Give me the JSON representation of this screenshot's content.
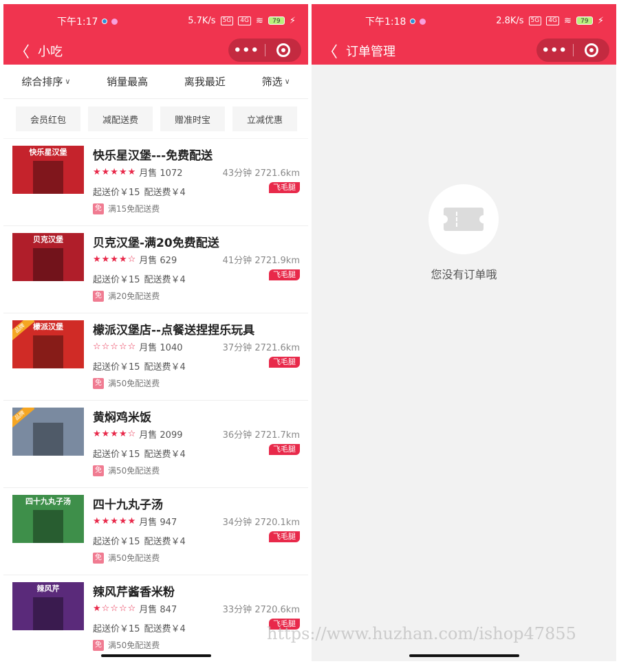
{
  "left": {
    "status": {
      "time": "下午1:17",
      "speed": "5.7K/s",
      "battery": "79"
    },
    "title": "小吃",
    "sort": [
      "综合排序",
      "销量最高",
      "离我最近",
      "筛选"
    ],
    "chips": [
      "会员红包",
      "减配送费",
      "赠准时宝",
      "立减优惠"
    ],
    "stores": [
      {
        "name": "快乐星汉堡---免费配送",
        "stars": "★★★★★",
        "sales": "月售 1072",
        "time_dist": "43分钟  2721.6km",
        "min_price": "起送价￥15",
        "delivery_fee": "配送费￥4",
        "badge": "飞毛腿",
        "promo_icon": "免",
        "promo": "满15免配送费",
        "sign": "快乐星汉堡",
        "color": "#c5232c"
      },
      {
        "name": "贝克汉堡-满20免费配送",
        "stars": "★★★★☆",
        "sales": "月售 629",
        "time_dist": "41分钟  2721.9km",
        "min_price": "起送价￥15",
        "delivery_fee": "配送费￥4",
        "badge": "飞毛腿",
        "promo_icon": "免",
        "promo": "满20免配送费",
        "sign": "贝克汉堡",
        "color": "#b01e2a"
      },
      {
        "name": "檬派汉堡店--点餐送捏捏乐玩具",
        "stars": "☆☆☆☆☆",
        "sales": "月售 1040",
        "time_dist": "37分钟  2721.6km",
        "min_price": "起送价￥15",
        "delivery_fee": "配送费￥4",
        "badge": "飞毛腿",
        "promo_icon": "免",
        "promo": "满50免配送费",
        "sign": "檬派汉堡",
        "color": "#d02b26",
        "tag": "品牌"
      },
      {
        "name": "黄焖鸡米饭",
        "stars": "★★★★☆",
        "sales": "月售 2099",
        "time_dist": "36分钟  2721.7km",
        "min_price": "起送价￥15",
        "delivery_fee": "配送费￥4",
        "badge": "飞毛腿",
        "promo_icon": "免",
        "promo": "满50免配送费",
        "sign": "",
        "color": "#7a8aa0",
        "tag": "品牌"
      },
      {
        "name": "四十九丸子汤",
        "stars": "★★★★★",
        "sales": "月售 947",
        "time_dist": "34分钟  2720.1km",
        "min_price": "起送价￥15",
        "delivery_fee": "配送费￥4",
        "badge": "飞毛腿",
        "promo_icon": "免",
        "promo": "满50免配送费",
        "sign": "四十九丸子汤",
        "color": "#3e8f4a"
      },
      {
        "name": "辣风芹酱香米粉",
        "stars": "★☆☆☆☆",
        "sales": "月售 847",
        "time_dist": "33分钟  2720.6km",
        "min_price": "起送价￥15",
        "delivery_fee": "配送费￥4",
        "badge": "飞毛腿",
        "promo_icon": "免",
        "promo": "满50免配送费",
        "sign": "辣风芹",
        "color": "#5a2a7a"
      }
    ]
  },
  "right": {
    "status": {
      "time": "下午1:18",
      "speed": "2.8K/s",
      "battery": "79"
    },
    "title": "订单管理",
    "empty_text": "您没有订单哦"
  },
  "watermark": "https://www.huzhan.com/ishop47855",
  "colors": {
    "brand": "#f0344f",
    "star": "#e8294a"
  }
}
